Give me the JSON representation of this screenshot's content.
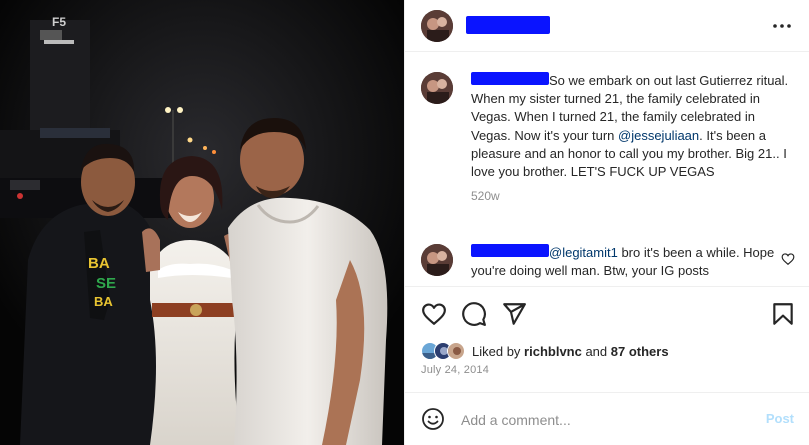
{
  "post": {
    "caption_text": "So we embark on out last Gutierrez ritual. When my sister turned 21, the family celebrated in Vegas. When I turned 21, the family celebrated in Vegas. Now it's your turn",
    "caption_mention": "@jessejuliaan",
    "caption_rest": ". It's been a pleasure and an honor to call you my brother. Big 21.. I love you brother. LET'S FUCK UP VEGAS",
    "caption_age": "520w"
  },
  "comment": {
    "mention": "@legitamit1",
    "text": " bro it's been a while. Hope you're doing well man. Btw, your IG posts"
  },
  "likes": {
    "prefix": "Liked by ",
    "user": "richblvnc",
    "connector": " and ",
    "others": "87 others"
  },
  "date": "July 24, 2014",
  "add_comment": {
    "placeholder": "Add a comment...",
    "post_label": "Post"
  },
  "icons": {
    "more": "more-horizontal-icon",
    "like": "heart-icon",
    "comment": "comment-icon",
    "share": "send-icon",
    "save": "bookmark-icon",
    "emoji": "emoji-icon"
  },
  "colors": {
    "redaction": "#0a14ff",
    "mention": "#00376b",
    "post_disabled": "#b2dffc",
    "muted": "#8e8e8e"
  }
}
